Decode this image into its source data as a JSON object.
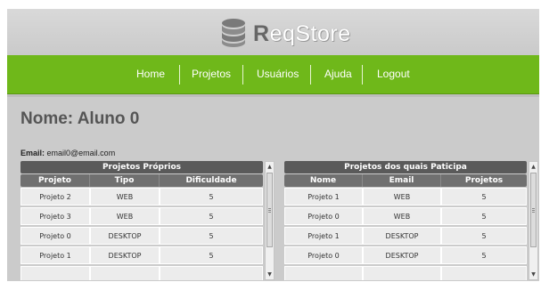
{
  "app": {
    "logo_text": "ReqStore"
  },
  "nav": {
    "items": [
      {
        "label": "Home"
      },
      {
        "label": "Projetos"
      },
      {
        "label": "Usuários"
      },
      {
        "label": "Ajuda"
      },
      {
        "label": "Logout"
      }
    ]
  },
  "profile": {
    "title": "Nome: Aluno 0",
    "email_label": "Email:",
    "email_value": "email0@email.com"
  },
  "own_projects": {
    "caption": "Projetos Próprios",
    "columns": [
      "Projeto",
      "Tipo",
      "Dificuldade"
    ],
    "rows": [
      [
        "Projeto 2",
        "WEB",
        "5"
      ],
      [
        "Projeto 3",
        "WEB",
        "5"
      ],
      [
        "Projeto 0",
        "DESKTOP",
        "5"
      ],
      [
        "Projeto 1",
        "DESKTOP",
        "5"
      ]
    ]
  },
  "participating_projects": {
    "caption": "Projetos dos quais Paticipa",
    "columns": [
      "Nome",
      "Email",
      "Projetos"
    ],
    "rows": [
      [
        "Projeto 1",
        "WEB",
        "5"
      ],
      [
        "Projeto 0",
        "WEB",
        "5"
      ],
      [
        "Projeto 1",
        "DESKTOP",
        "5"
      ],
      [
        "Projeto 0",
        "DESKTOP",
        "5"
      ]
    ]
  },
  "colors": {
    "nav_green": "#6fb81a",
    "caption_bg": "#5a5a5a",
    "header_bg": "#707070"
  }
}
